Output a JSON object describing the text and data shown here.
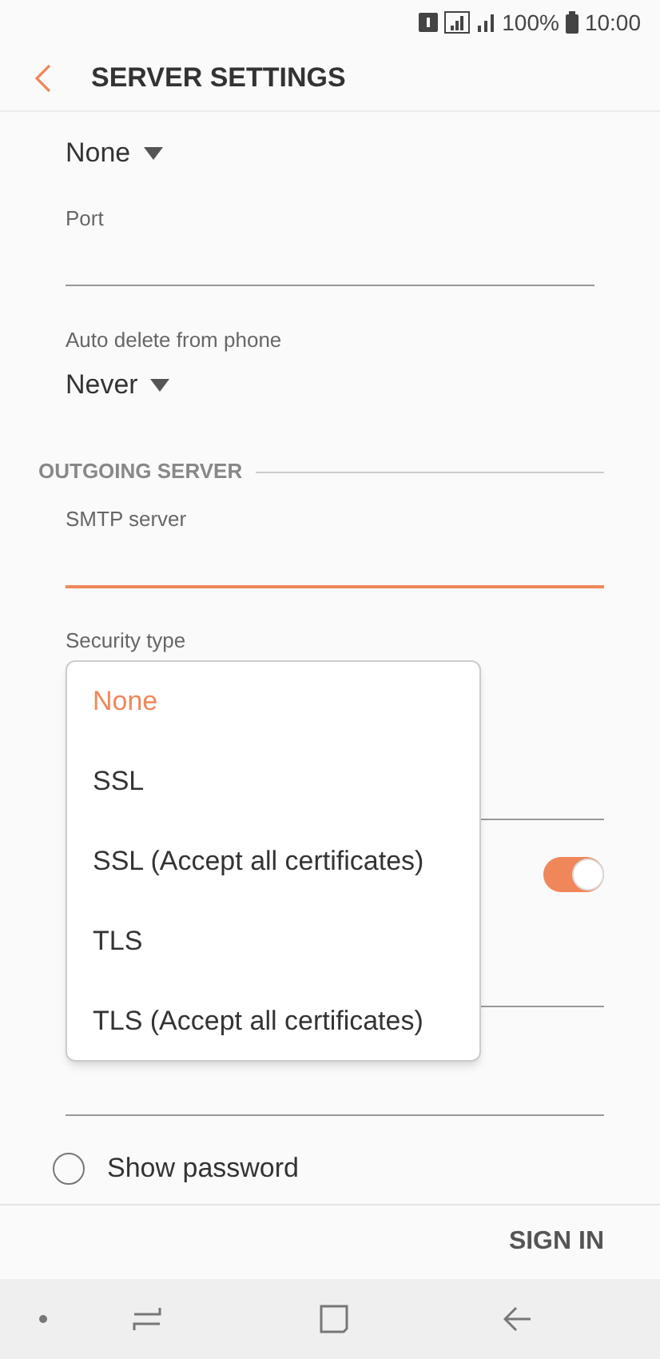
{
  "status_bar": {
    "battery": "100%",
    "time": "10:00"
  },
  "header": {
    "title": "SERVER SETTINGS"
  },
  "incoming": {
    "security_value": "None",
    "port_label": "Port",
    "auto_delete_label": "Auto delete from phone",
    "auto_delete_value": "Never"
  },
  "outgoing": {
    "heading": "OUTGOING SERVER",
    "smtp_label": "SMTP server",
    "smtp_focused": true,
    "security_label": "Security type",
    "toggle_on": true
  },
  "dropdown": {
    "options": [
      {
        "label": "None",
        "selected": true
      },
      {
        "label": "SSL",
        "selected": false
      },
      {
        "label": "SSL (Accept all certificates)",
        "selected": false
      },
      {
        "label": "TLS",
        "selected": false
      },
      {
        "label": "TLS (Accept all certificates)",
        "selected": false
      }
    ]
  },
  "show_password": {
    "label": "Show password",
    "checked": false
  },
  "action": "SIGN IN"
}
